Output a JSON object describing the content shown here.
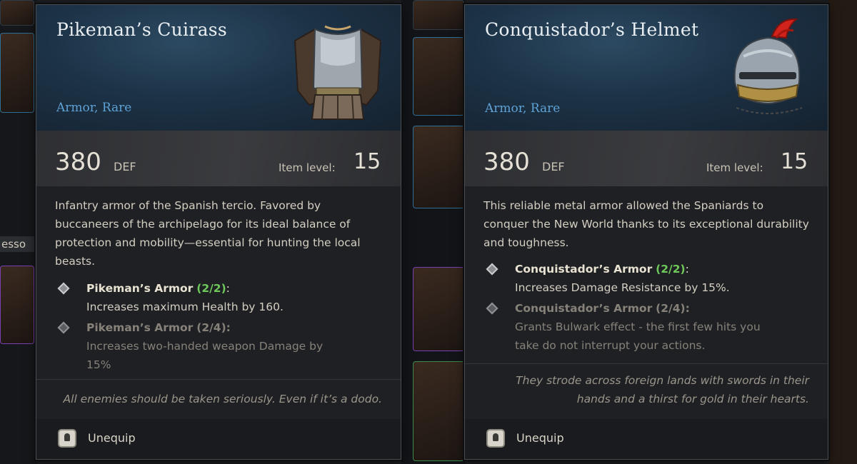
{
  "sidebar_left": {
    "slot_label": "esso"
  },
  "tooltips": [
    {
      "title": "Pikeman’s Cuirass",
      "subtitle": "Armor, Rare",
      "def_value": "380",
      "def_unit": "DEF",
      "item_level_label": "Item level:",
      "item_level": "15",
      "description": "Infantry armor of the Spanish tercio. Favored by buccaneers of the archipelago for its ideal balance of protection and mobility—essential for hunting the local beasts.",
      "set_bonuses": [
        {
          "name": "Pikeman’s Armor",
          "count": "(2/2)",
          "effect": "Increases maximum Health by 160.",
          "active": true
        },
        {
          "name": "Pikeman’s Armor",
          "count": "(2/4)",
          "effect": "Increases two-handed weapon Damage by 15%",
          "active": false
        }
      ],
      "flavor": "All enemies should be taken seriously. Even if it’s a dodo.",
      "action_label": "Unequip",
      "icon": "cuirass-icon"
    },
    {
      "title": "Conquistador’s Helmet",
      "subtitle": "Armor, Rare",
      "def_value": "380",
      "def_unit": "DEF",
      "item_level_label": "Item level:",
      "item_level": "15",
      "description": "This reliable metal armor allowed the Spaniards to conquer the New World thanks to its exceptional durability and toughness.",
      "set_bonuses": [
        {
          "name": "Conquistador’s Armor",
          "count": "(2/2)",
          "effect": "Increases Damage Resistance by 15%.",
          "active": true
        },
        {
          "name": "Conquistador’s Armor",
          "count": "(2/4)",
          "effect": "Grants Bulwark effect - the first few hits you take do not interrupt your actions.",
          "active": false
        }
      ],
      "flavor": "They strode across foreign lands with swords in their hands and a thirst for gold in their hearts.",
      "action_label": "Unequip",
      "icon": "helmet-icon"
    }
  ],
  "colors": {
    "rarity": "#5fa2d6",
    "set_active": "#6fc95a"
  }
}
